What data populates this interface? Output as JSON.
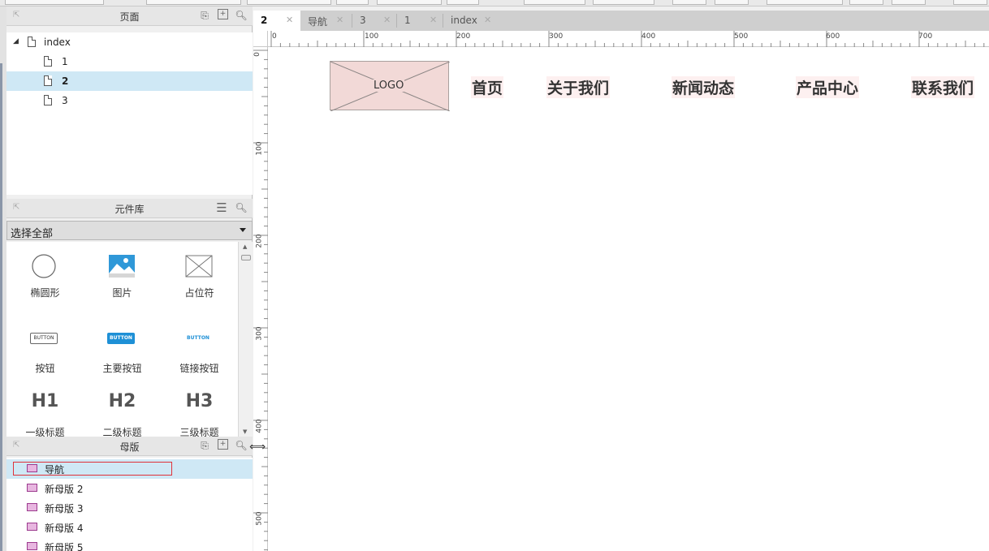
{
  "pages_panel": {
    "title": "页面",
    "pages": [
      {
        "label": "index",
        "level": 0
      },
      {
        "label": "1",
        "level": 1
      },
      {
        "label": "2",
        "level": 1,
        "selected": true
      },
      {
        "label": "3",
        "level": 1
      }
    ]
  },
  "library_panel": {
    "title": "元件库",
    "selector_value": "选择全部",
    "items": [
      {
        "label": "椭圆形",
        "icon": "ellipse-icon"
      },
      {
        "label": "图片",
        "icon": "image-icon"
      },
      {
        "label": "占位符",
        "icon": "placeholder-icon"
      },
      {
        "label": "按钮",
        "icon": "button-icon",
        "glyph": "BUTTON"
      },
      {
        "label": "主要按钮",
        "icon": "primary-button-icon",
        "glyph": "BUTTON"
      },
      {
        "label": "链接按钮",
        "icon": "link-button-icon",
        "glyph": "BUTTON"
      },
      {
        "label": "一级标题",
        "icon": "h1-icon",
        "glyph": "H1"
      },
      {
        "label": "二级标题",
        "icon": "h2-icon",
        "glyph": "H2"
      },
      {
        "label": "三级标题",
        "icon": "h3-icon",
        "glyph": "H3"
      }
    ]
  },
  "masters_panel": {
    "title": "母版",
    "masters": [
      {
        "label": "导航",
        "selected": true
      },
      {
        "label": "新母版 2"
      },
      {
        "label": "新母版 3"
      },
      {
        "label": "新母版 4"
      },
      {
        "label": "新母版 5"
      }
    ]
  },
  "tabs": [
    {
      "label": "2",
      "active": true
    },
    {
      "label": "导航"
    },
    {
      "label": "3"
    },
    {
      "label": "1"
    },
    {
      "label": "index"
    }
  ],
  "ruler": {
    "top_labels": [
      "0",
      "100",
      "200",
      "300",
      "400",
      "500",
      "600",
      "700"
    ],
    "left_labels": [
      "0",
      "100",
      "200",
      "300",
      "400",
      "500"
    ]
  },
  "canvas": {
    "logo_label": "LOGO",
    "nav_items": [
      "首页",
      "关于我们",
      "新闻动态",
      "产品中心",
      "联系我们"
    ]
  },
  "colors": {
    "selection": "#cfe8f5",
    "logo_fill": "#f2d9d7",
    "primary_button": "#1e90d6",
    "master_icon": "#e8b6e0",
    "highlight_border": "#e0323a"
  }
}
